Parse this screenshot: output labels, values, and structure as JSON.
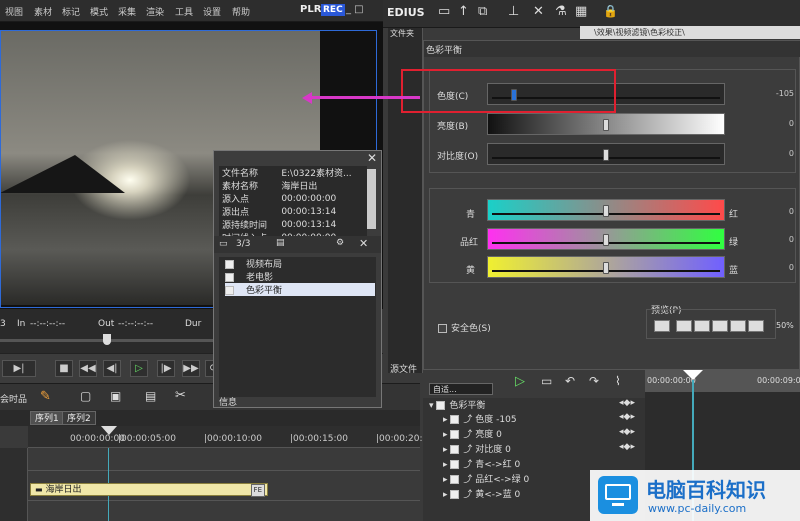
{
  "menubar": {
    "items": [
      "视图",
      "素材",
      "标记",
      "模式",
      "采集",
      "渲染",
      "工具",
      "设置",
      "帮助"
    ],
    "plr": "PLR",
    "rec": "REC",
    "win_btns": "_ □"
  },
  "editor": {
    "logo": "EDIUS",
    "bin_label": "文件夹",
    "path": "\\效果\\视频滤镜\\色彩校正\\",
    "source_label": "源文件"
  },
  "preview": {
    "timecode_prefix": "3",
    "in_label": "In",
    "in_value": "--:--:--:--",
    "out_label": "Out",
    "out_value": "--:--:--:--",
    "dur_label": "Dur",
    "dur_value": "--:--:--:--"
  },
  "transport": {
    "buttons": [
      "▶|",
      "■",
      "◀◀",
      "◀|",
      "▷",
      "|▶",
      "▶▶",
      "⟳"
    ]
  },
  "timeline": {
    "tabs": [
      "序列1",
      "序列2"
    ],
    "ruler": [
      "00:00:00:00",
      "|00:00:05:00",
      "|00:00:10:00",
      "|00:00:15:00",
      "|00:00:20:"
    ],
    "clip_label": "海岸日出",
    "clip_badge": "FE",
    "side_label": "会时品"
  },
  "info": {
    "rows": [
      [
        "文件名称",
        "E:\\0322素材资..."
      ],
      [
        "素材名称",
        "海岸日出"
      ],
      [
        "源入点",
        "00:00:00:00"
      ],
      [
        "源出点",
        "00:00:13:14"
      ],
      [
        "源持续时间",
        "00:00:13:14"
      ],
      [
        "时间线入点",
        "00:00:00:00"
      ]
    ],
    "count": "3/3",
    "fx_items": [
      "视频布局",
      "老电影",
      "色彩平衡"
    ],
    "footer": "信息"
  },
  "color_balance": {
    "title": "色彩平衡",
    "sliders": [
      {
        "label": "色度(C)",
        "value": "-105",
        "pos": 0.12
      },
      {
        "label": "亮度(B)",
        "value": "0",
        "pos": 0.5
      },
      {
        "label": "对比度(O)",
        "value": "0",
        "pos": 0.5
      }
    ],
    "color_sliders": [
      {
        "left": "青",
        "right": "红",
        "value": "0",
        "pos": 0.5
      },
      {
        "left": "品红",
        "right": "绿",
        "value": "0",
        "pos": 0.5
      },
      {
        "left": "黄",
        "right": "蓝",
        "value": "0",
        "pos": 0.5
      }
    ],
    "safe_color": "安全色(S)",
    "preview_label": "预览(P)",
    "zoom": "50%"
  },
  "fx_panel": {
    "dropdown": "自适...",
    "tree_root": "色彩平衡",
    "params": [
      {
        "name": "色度",
        "value": "-105"
      },
      {
        "name": "亮度",
        "value": "0"
      },
      {
        "name": "对比度",
        "value": "0"
      },
      {
        "name": "青<->红",
        "value": "0"
      },
      {
        "name": "品红<->绿",
        "value": "0"
      },
      {
        "name": "黄<->蓝",
        "value": "0"
      }
    ],
    "ruler": [
      "00:00:00:00",
      "00:00:09:0"
    ]
  },
  "watermark": {
    "title": "电脑百科知识",
    "url": "www.pc-daily.com"
  },
  "colors": {
    "rec": "#2a58d8",
    "annot": "#e02030",
    "arrow": "#d838c8",
    "clip": "#f0e7a8",
    "wm_blue": "#1b8fe0"
  }
}
